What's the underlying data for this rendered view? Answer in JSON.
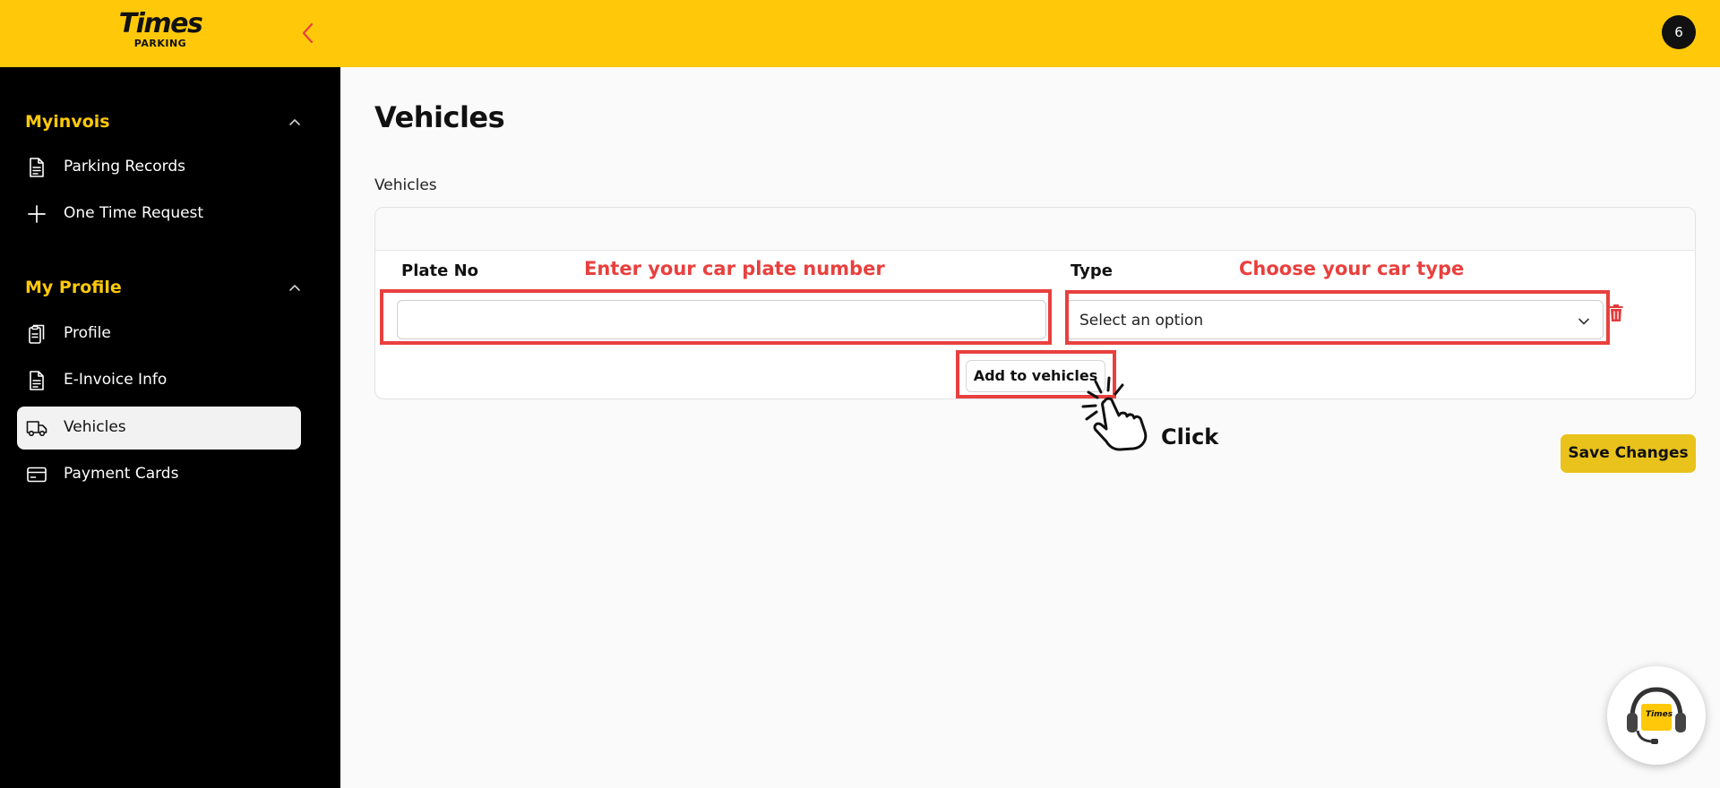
{
  "app": {
    "logo_main": "Times",
    "logo_sub": "PARKING",
    "notification_count": "6",
    "brand_color": "#ffc90a"
  },
  "sidebar": {
    "sections": [
      {
        "label": "Myinvois",
        "items": [
          {
            "label": "Parking Records",
            "icon": "document-icon"
          },
          {
            "label": "One Time Request",
            "icon": "plus-icon"
          }
        ]
      },
      {
        "label": "My Profile",
        "items": [
          {
            "label": "Profile",
            "icon": "clipboard-icon"
          },
          {
            "label": "E-Invoice Info",
            "icon": "document-icon"
          },
          {
            "label": "Vehicles",
            "icon": "truck-icon",
            "active": true
          },
          {
            "label": "Payment Cards",
            "icon": "credit-card-icon"
          }
        ]
      }
    ]
  },
  "main": {
    "title": "Vehicles",
    "section_label": "Vehicles",
    "form": {
      "plate_label": "Plate No",
      "plate_value": "",
      "type_label": "Type",
      "type_placeholder": "Select an option",
      "add_button": "Add to vehicles"
    },
    "save_button": "Save Changes"
  },
  "annotations": {
    "plate_hint": "Enter your car plate number",
    "type_hint": "Choose your car type",
    "click_hint": "Click",
    "color": "#e8403e"
  },
  "support": {
    "icon": "headset-support-icon",
    "badge_text": "Times"
  }
}
